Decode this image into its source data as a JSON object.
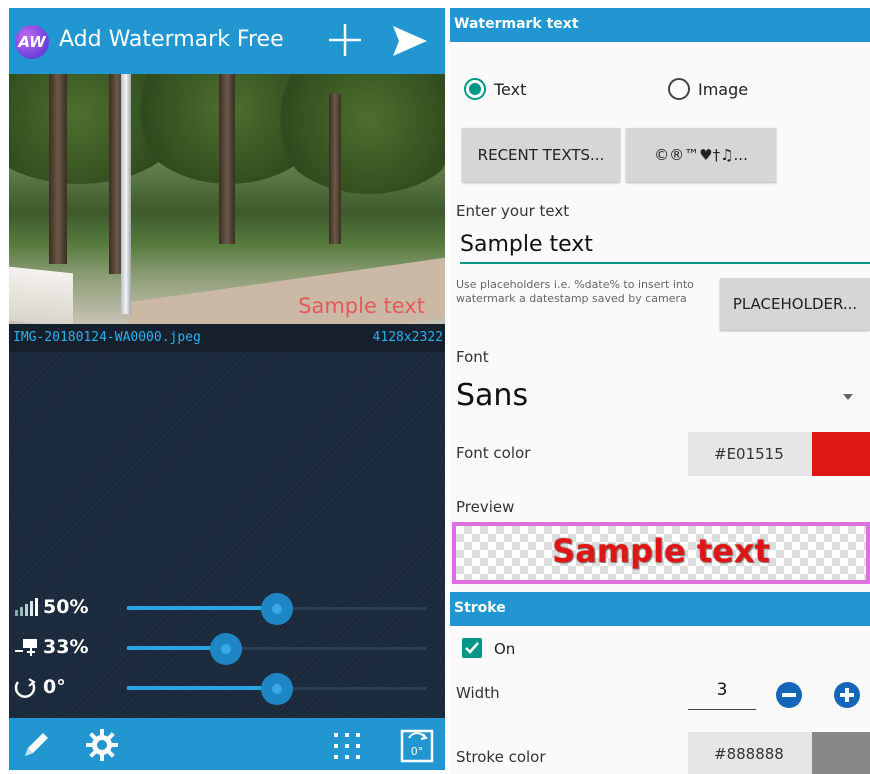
{
  "app": {
    "logo_text": "AW",
    "title": "Add Watermark Free"
  },
  "image": {
    "watermark_text": "Sample text",
    "filename": "IMG-20180124-WA0000.jpeg",
    "resolution": "4128x2322"
  },
  "sliders": [
    {
      "icon": "opacity-icon",
      "label": "50%",
      "value": 0.5
    },
    {
      "icon": "size-icon",
      "label": "33%",
      "value": 0.33
    },
    {
      "icon": "rotation-icon",
      "label": "0°",
      "value": 0.5
    }
  ],
  "bottom_bar": {
    "rotate_label": "0°"
  },
  "panel": {
    "header": "Watermark text",
    "radio_text": "Text",
    "radio_image": "Image",
    "selected_type": "Text",
    "recent_button": "RECENT TEXTS...",
    "symbols_button": "©®™♥†♫...",
    "enter_label": "Enter your text",
    "text_value": "Sample text",
    "hint": "Use placeholders i.e. %date% to insert into watermark a datestamp saved by camera",
    "placeholder_button": "PLACEHOLDER...",
    "font_label": "Font",
    "font_value": "Sans",
    "font_color_label": "Font color",
    "font_color": "#E01515",
    "preview_label": "Preview",
    "preview_text": "Sample text"
  },
  "stroke": {
    "header": "Stroke",
    "enabled": true,
    "on_label": "On",
    "width_label": "Width",
    "width_value": "3",
    "color_label": "Stroke color",
    "color": "#888888"
  },
  "colors": {
    "accent": "#2196d0",
    "teal": "#009688",
    "font_color_swatch": "#e01515",
    "stroke_color_swatch": "#888888"
  }
}
